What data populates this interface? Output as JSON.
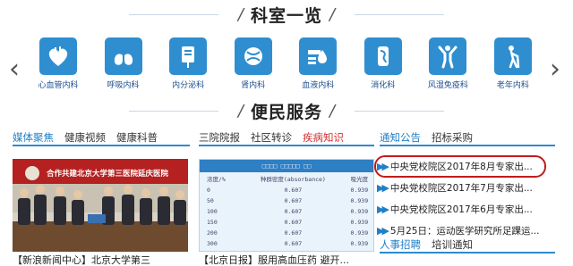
{
  "departments_section": {
    "title": "科室一览",
    "slash": "/",
    "prev_arrow": "‹",
    "next_arrow": "›",
    "items": [
      {
        "label": "心血管内科",
        "icon": "heart-icon"
      },
      {
        "label": "呼吸内科",
        "icon": "lungs-icon"
      },
      {
        "label": "内分泌科",
        "icon": "iv-bag-icon"
      },
      {
        "label": "肾内科",
        "icon": "kidney-icon"
      },
      {
        "label": "血液内科",
        "icon": "blood-drop-icon"
      },
      {
        "label": "消化科",
        "icon": "stomach-icon"
      },
      {
        "label": "风湿免疫科",
        "icon": "person-arms-icon"
      },
      {
        "label": "老年内科",
        "icon": "elderly-cane-icon"
      }
    ]
  },
  "services_section": {
    "title": "便民服务",
    "slash": "/"
  },
  "media_column": {
    "tabs": [
      "媒体聚焦",
      "健康视频",
      "健康科普"
    ],
    "photo_banner_text": "合作共建北京大学第三医院延庆医院",
    "caption": "【新浪新闻中心】北京大学第三"
  },
  "report_column": {
    "tabs": [
      "三院院报",
      "社区转诊",
      "疾病知识"
    ],
    "table": {
      "header": "□□□□ □□□□□ □□",
      "col_headers": [
        "浓度/%",
        "种群密度(absorbance)",
        "吸光度"
      ],
      "rows": [
        [
          "0",
          "0.607",
          "0.939"
        ],
        [
          "50",
          "0.607",
          "0.939"
        ],
        [
          "100",
          "0.607",
          "0.939"
        ],
        [
          "150",
          "0.607",
          "0.939"
        ],
        [
          "200",
          "0.607",
          "0.939"
        ],
        [
          "300",
          "0.607",
          "0.939"
        ]
      ]
    },
    "caption": "【北京日报】服用高血压药 避开..."
  },
  "notice_column": {
    "tabs": [
      "通知公告",
      "招标采购"
    ],
    "items": [
      "中央党校院区2017年8月专家出...",
      "中央党校院区2017年7月专家出...",
      "中央党校院区2017年6月专家出...",
      "5月25日：运动医学研究所足踝运..."
    ],
    "bottom_tabs": [
      "人事招聘",
      "培训通知"
    ]
  },
  "colors": {
    "accent_blue": "#2f8ed0",
    "tab_blue": "#1f7fc7",
    "highlight_red": "#c21a1a"
  }
}
